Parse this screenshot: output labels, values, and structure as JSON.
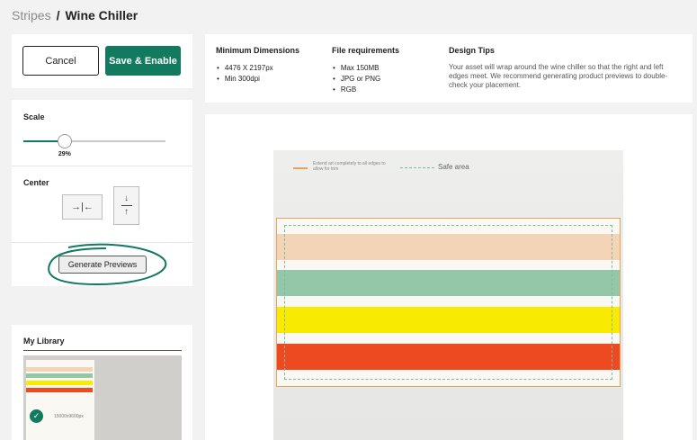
{
  "breadcrumb": {
    "parent": "Stripes",
    "separator": "/",
    "current": "Wine Chiller"
  },
  "actions": {
    "cancel_label": "Cancel",
    "save_label": "Save & Enable"
  },
  "controls": {
    "scale_label": "Scale",
    "scale_value_text": "29%",
    "scale_fraction": 0.29,
    "center_label": "Center",
    "center_horizontal_icon": "→|←",
    "center_vertical_top": "↓",
    "center_vertical_bottom": "↑",
    "generate_label": "Generate Previews"
  },
  "library": {
    "title": "My Library",
    "thumb_size": "15000x9600px"
  },
  "info": {
    "min_dimensions": {
      "title": "Minimum Dimensions",
      "items": [
        "4476 X 2197px",
        "Min 300dpi"
      ]
    },
    "file_requirements": {
      "title": "File requirements",
      "items": [
        "Max 150MB",
        "JPG or PNG",
        "RGB"
      ]
    },
    "design_tips": {
      "title": "Design Tips",
      "text": "Your asset will wrap around the wine chiller so that the right and left edges meet. We recommend generating product previews to double-check your placement."
    }
  },
  "preview": {
    "legend_trim": "Extend art completely to all edges to allow for trim",
    "legend_safe": "Safe area"
  },
  "colors": {
    "brand_green": "#127a5e",
    "stripe_peach": "#f4d4b6",
    "stripe_green": "#93c7a7",
    "stripe_yellow": "#f8ea00",
    "stripe_red": "#ee4a22",
    "trim_orange": "#e9a25a"
  }
}
